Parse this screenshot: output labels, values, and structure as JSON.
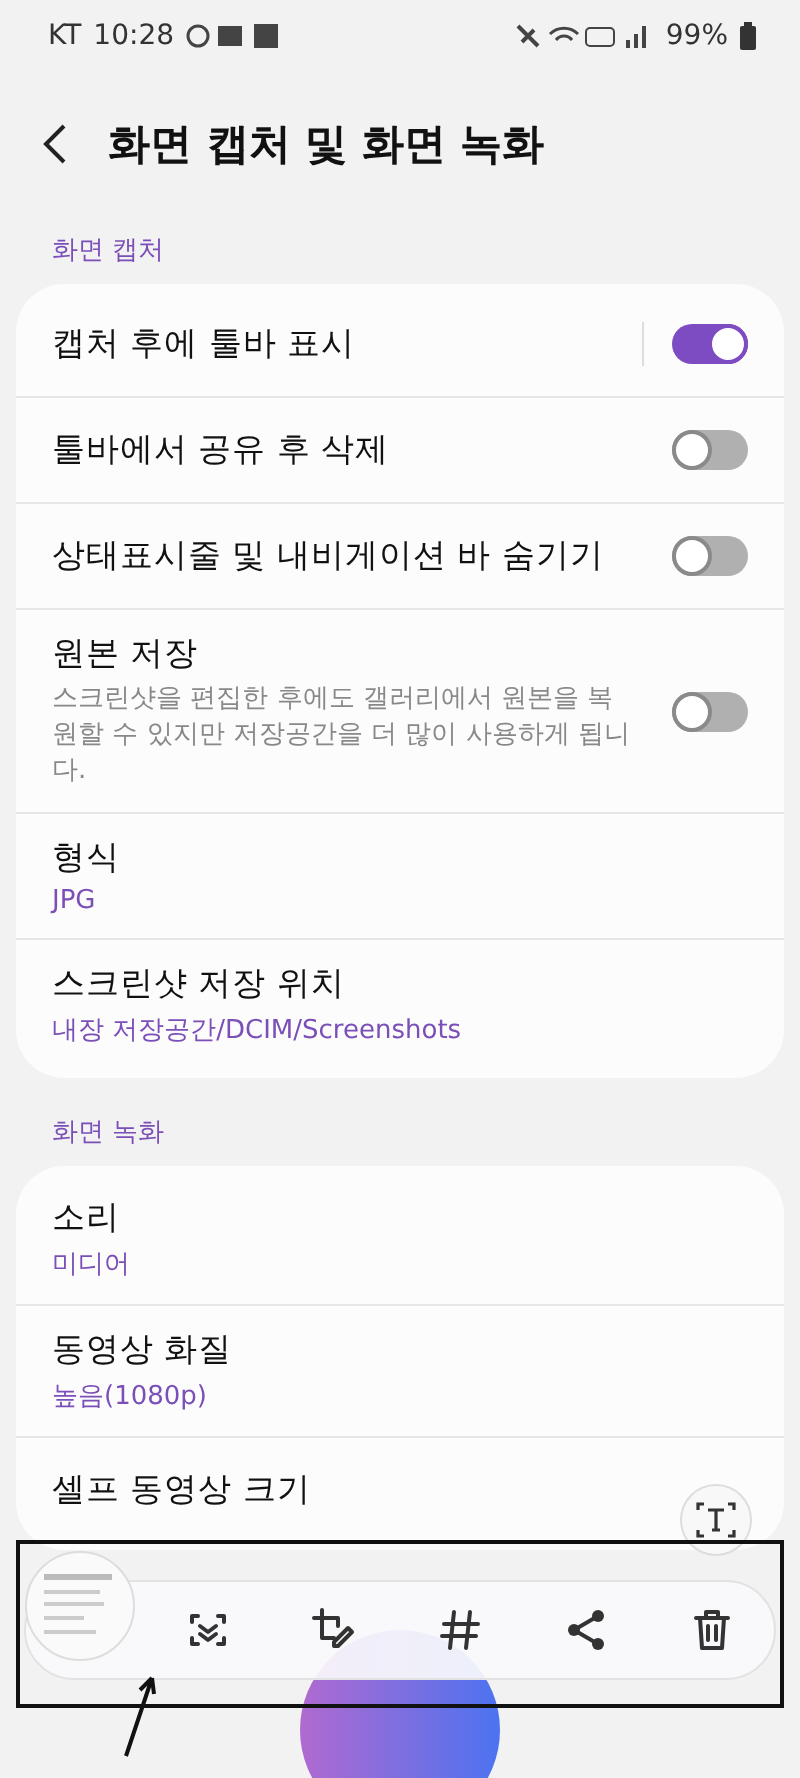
{
  "status_bar": {
    "carrier": "KT",
    "time": "10:28",
    "battery": "99%"
  },
  "header": {
    "title": "화면 캡처 및 화면 녹화"
  },
  "sections": [
    {
      "title": "화면 캡처",
      "rows": [
        {
          "kind": "switch",
          "title": "캡처 후에 툴바 표시",
          "on": true,
          "divider": true
        },
        {
          "kind": "switch",
          "title": "툴바에서 공유 후 삭제",
          "on": false
        },
        {
          "kind": "switch",
          "title": "상태표시줄 및 내비게이션 바 숨기기",
          "on": false
        },
        {
          "kind": "switch",
          "title": "원본 저장",
          "description": "스크린샷을 편집한 후에도 갤러리에서 원본을 복원할 수 있지만 저장공간을 더 많이 사용하게 됩니다.",
          "on": false
        },
        {
          "kind": "value",
          "title": "형식",
          "value": "JPG"
        },
        {
          "kind": "value",
          "title": "스크린샷 저장 위치",
          "value": "내장 저장공간/DCIM/Screenshots"
        }
      ]
    },
    {
      "title": "화면 녹화",
      "rows": [
        {
          "kind": "value",
          "title": "소리",
          "value": "미디어"
        },
        {
          "kind": "value",
          "title": "동영상 화질",
          "value": "높음(1080p)"
        },
        {
          "kind": "plain",
          "title": "셀프 동영상 크기"
        }
      ]
    }
  ]
}
